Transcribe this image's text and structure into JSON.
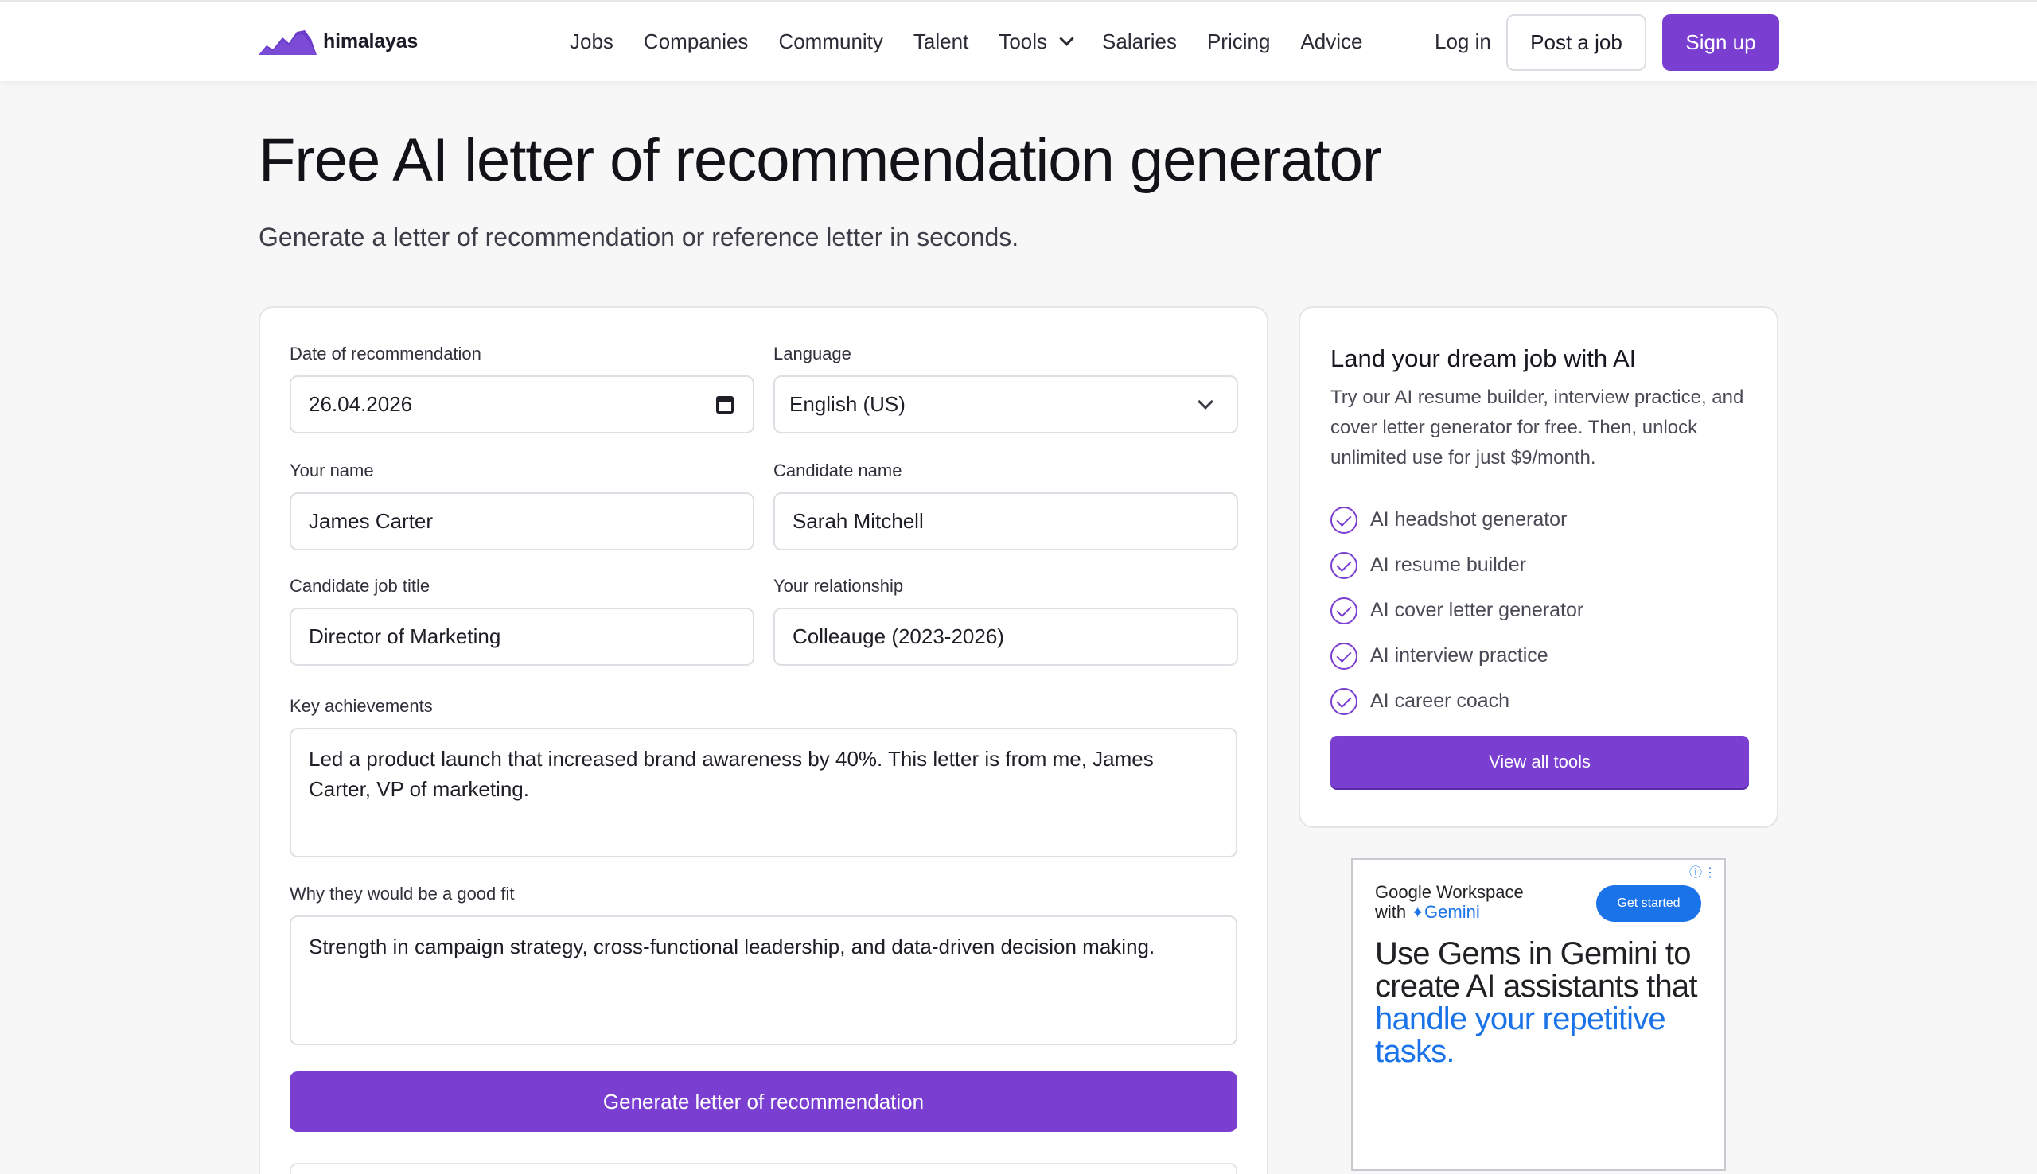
{
  "nav": {
    "logo_text": "himalayas",
    "links": [
      "Jobs",
      "Companies",
      "Community",
      "Talent",
      "Tools",
      "Salaries",
      "Pricing",
      "Advice"
    ],
    "login": "Log in",
    "post_job": "Post a job",
    "sign_up": "Sign up"
  },
  "hero": {
    "title": "Free AI letter of recommendation generator",
    "subtitle": "Generate a letter of recommendation or reference letter in seconds."
  },
  "form": {
    "date_label": "Date of recommendation",
    "date_value": "26.04.2026",
    "language_label": "Language",
    "language_value": "English (US)",
    "your_name_label": "Your name",
    "your_name_value": "James Carter",
    "candidate_name_label": "Candidate name",
    "candidate_name_value": "Sarah Mitchell",
    "job_title_label": "Candidate job title",
    "job_title_value": "Director of Marketing",
    "relationship_label": "Your relationship",
    "relationship_value": "Colleauge (2023-2026)",
    "achievements_label": "Key achievements",
    "achievements_value": "Led a product launch that increased brand awareness by 40%. This letter is from me, James Carter, VP of marketing.",
    "good_fit_label": "Why they would be a good fit",
    "good_fit_value": "Strength in campaign strategy, cross-functional leadership, and data-driven decision making.",
    "generate_button": "Generate letter of recommendation"
  },
  "side": {
    "title": "Land your dream job with AI",
    "description": "Try our AI resume builder, interview practice, and cover letter generator for free. Then, unlock unlimited use for just $9/month.",
    "features": [
      "AI headshot generator",
      "AI resume builder",
      "AI cover letter generator",
      "AI interview practice",
      "AI career coach"
    ],
    "button": "View all tools"
  },
  "ad": {
    "brand_line1": "Google Workspace",
    "brand_with": "with",
    "brand_gemini": "Gemini",
    "cta": "Get started",
    "headline_main": "Use Gems in Gemini to create AI assistants that",
    "headline_blue": "handle your repetitive tasks."
  },
  "colors": {
    "accent": "#7a3fd1",
    "ad_blue": "#1a73e8"
  }
}
